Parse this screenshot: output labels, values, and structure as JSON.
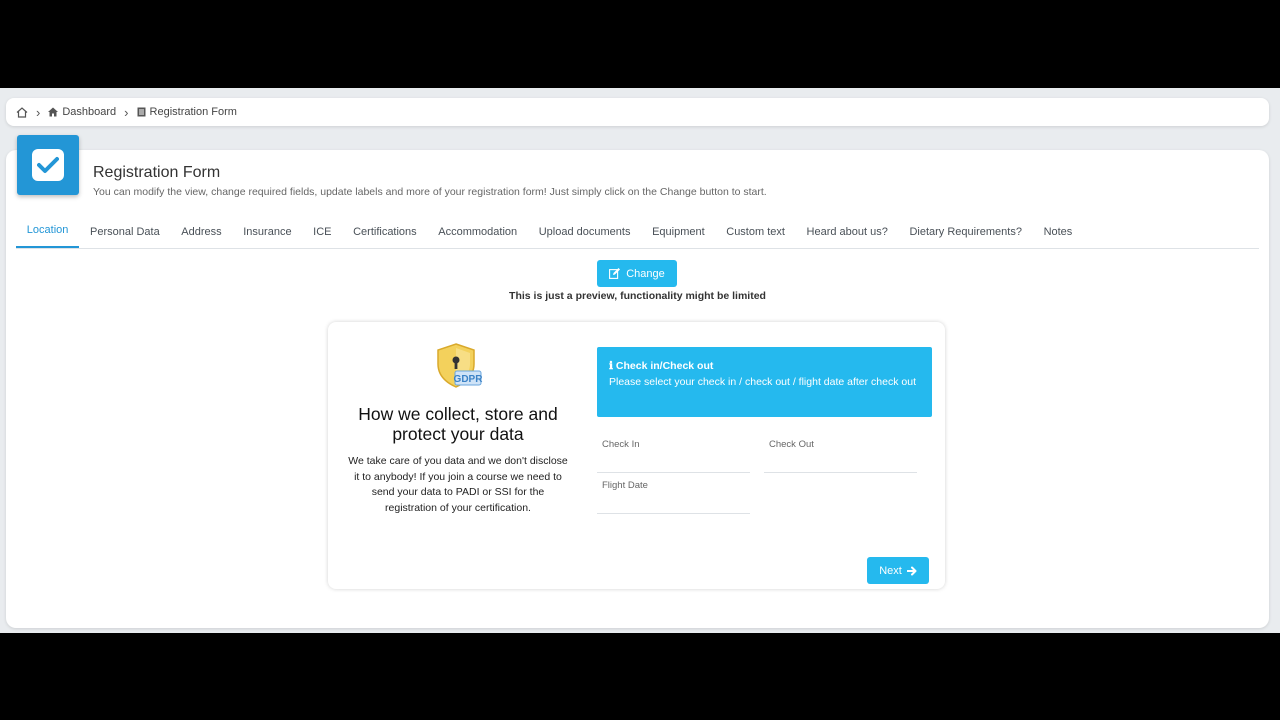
{
  "breadcrumb": {
    "home_icon": "home-icon",
    "items": [
      {
        "label": "Dashboard",
        "icon": "house-icon"
      },
      {
        "label": "Registration Form",
        "icon": "form-icon"
      }
    ]
  },
  "header": {
    "icon": "checkbox-icon",
    "title": "Registration Form",
    "subtitle": "You can modify the view, change required fields, update labels and more of your registration form! Just simply click on the Change button to start."
  },
  "tabs": [
    {
      "label": "Location",
      "active": true
    },
    {
      "label": "Personal Data"
    },
    {
      "label": "Address"
    },
    {
      "label": "Insurance"
    },
    {
      "label": "ICE"
    },
    {
      "label": "Certifications"
    },
    {
      "label": "Accommodation"
    },
    {
      "label": "Upload documents"
    },
    {
      "label": "Equipment"
    },
    {
      "label": "Custom text"
    },
    {
      "label": "Heard about us?"
    },
    {
      "label": "Dietary Requirements?"
    },
    {
      "label": "Notes"
    }
  ],
  "change_button": {
    "label": "Change",
    "icon": "edit-icon"
  },
  "preview_note": "This is just a preview, functionality might be limited",
  "gdpr": {
    "logo_text": "GDPR",
    "title": "How we collect, store and protect your data",
    "text": "We take care of you data and we don't disclose it to anybody! If you join a course we need to send your data to PADI or SSI for the registration of your certification."
  },
  "info_box": {
    "icon": "info-icon",
    "title": "Check in/Check out",
    "text": "Please select your check in / check out / flight date after check out"
  },
  "fields": {
    "check_in": {
      "label": "Check In",
      "value": ""
    },
    "check_out": {
      "label": "Check Out",
      "value": ""
    },
    "flight_date": {
      "label": "Flight Date",
      "value": ""
    }
  },
  "next_button": {
    "label": "Next",
    "icon": "arrow-right-icon"
  },
  "colors": {
    "accent": "#25b9ee",
    "primary": "#2396d6"
  }
}
